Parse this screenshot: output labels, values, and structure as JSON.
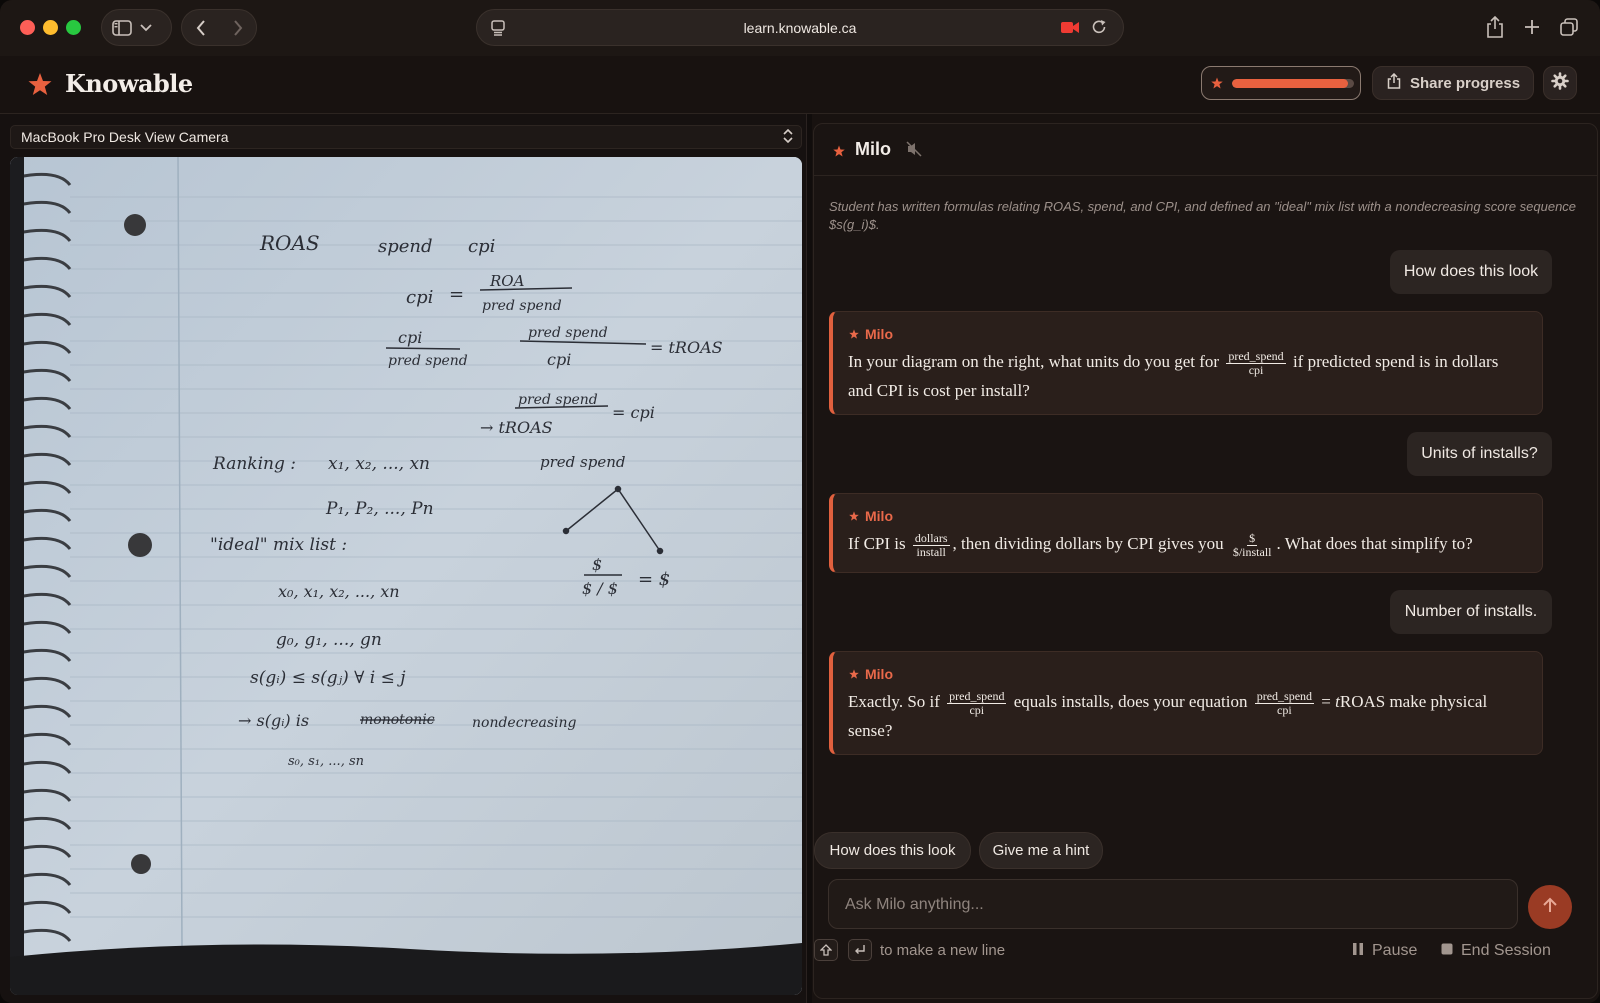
{
  "browser": {
    "url": "learn.knowable.ca"
  },
  "app": {
    "brand": "Knowable",
    "progress": {
      "value": 0.95
    },
    "share_label": "Share progress",
    "colors": {
      "accent": "#e8613f",
      "background": "#181210"
    }
  },
  "camera": {
    "selected": "MacBook Pro Desk View Camera"
  },
  "tutor": {
    "name": "Milo",
    "context_note": "Student has written formulas relating ROAS, spend, and CPI, and defined an \"ideal\" mix list with a nondecreasing score sequence $s(g_i)$.",
    "messages": [
      {
        "role": "user",
        "text": "How does this look"
      },
      {
        "role": "milo",
        "label": "Milo",
        "parts": {
          "a": "In your diagram on the right, what units do you get for",
          "frac_num": "pred_spend",
          "frac_den": "cpi",
          "b": "if predicted spend is in dollars and CPI is cost per install?"
        }
      },
      {
        "role": "user",
        "text": "Units of installs?"
      },
      {
        "role": "milo",
        "label": "Milo",
        "parts": {
          "a": "If CPI is",
          "frac1_num": "dollars",
          "frac1_den": "install",
          "b": ", then dividing dollars by CPI gives you",
          "frac2_num": "$",
          "frac2_den": "$/install",
          "c": ". What does that simplify to?"
        }
      },
      {
        "role": "user",
        "text": "Number of installs."
      },
      {
        "role": "milo",
        "label": "Milo",
        "parts": {
          "a": "Exactly. So if",
          "frac1_num": "pred_spend",
          "frac1_den": "cpi",
          "b": "equals installs, does your equation",
          "frac2_num": "pred_spend",
          "frac2_den": "cpi",
          "c": "= ",
          "d": "t",
          "e": "ROAS make physical sense?"
        }
      }
    ],
    "suggestions": [
      "How does this look",
      "Give me a hint"
    ],
    "input_placeholder": "Ask Milo anything...",
    "hint_text": "to make a new line",
    "pause_label": "Pause",
    "end_label": "End Session"
  },
  "notebook": {
    "lines": [
      "ROAS",
      "spend",
      "cpi",
      "cpi",
      "=",
      "ROA",
      "pred spend",
      "cpi",
      "pred spend",
      "pred spend",
      "cpi",
      "= tROAS",
      "pred spend",
      "= cpi",
      "→ tROAS",
      "Ranking :",
      "x₁, x₂, ..., xn",
      "pred spend",
      "P₁, P₂, ..., Pn",
      "\"ideal\" mix list :",
      "x₀, x₁, x₂, ..., xn",
      "g₀, g₁, ..., gn",
      "s(gᵢ) ≤ s(gⱼ)  ∀ i ≤ j",
      "→ s(gᵢ) is",
      "monotonic",
      "nondecreasing",
      "s₀, s₁, ..., sn",
      "$",
      "$ / $",
      "= $"
    ]
  }
}
